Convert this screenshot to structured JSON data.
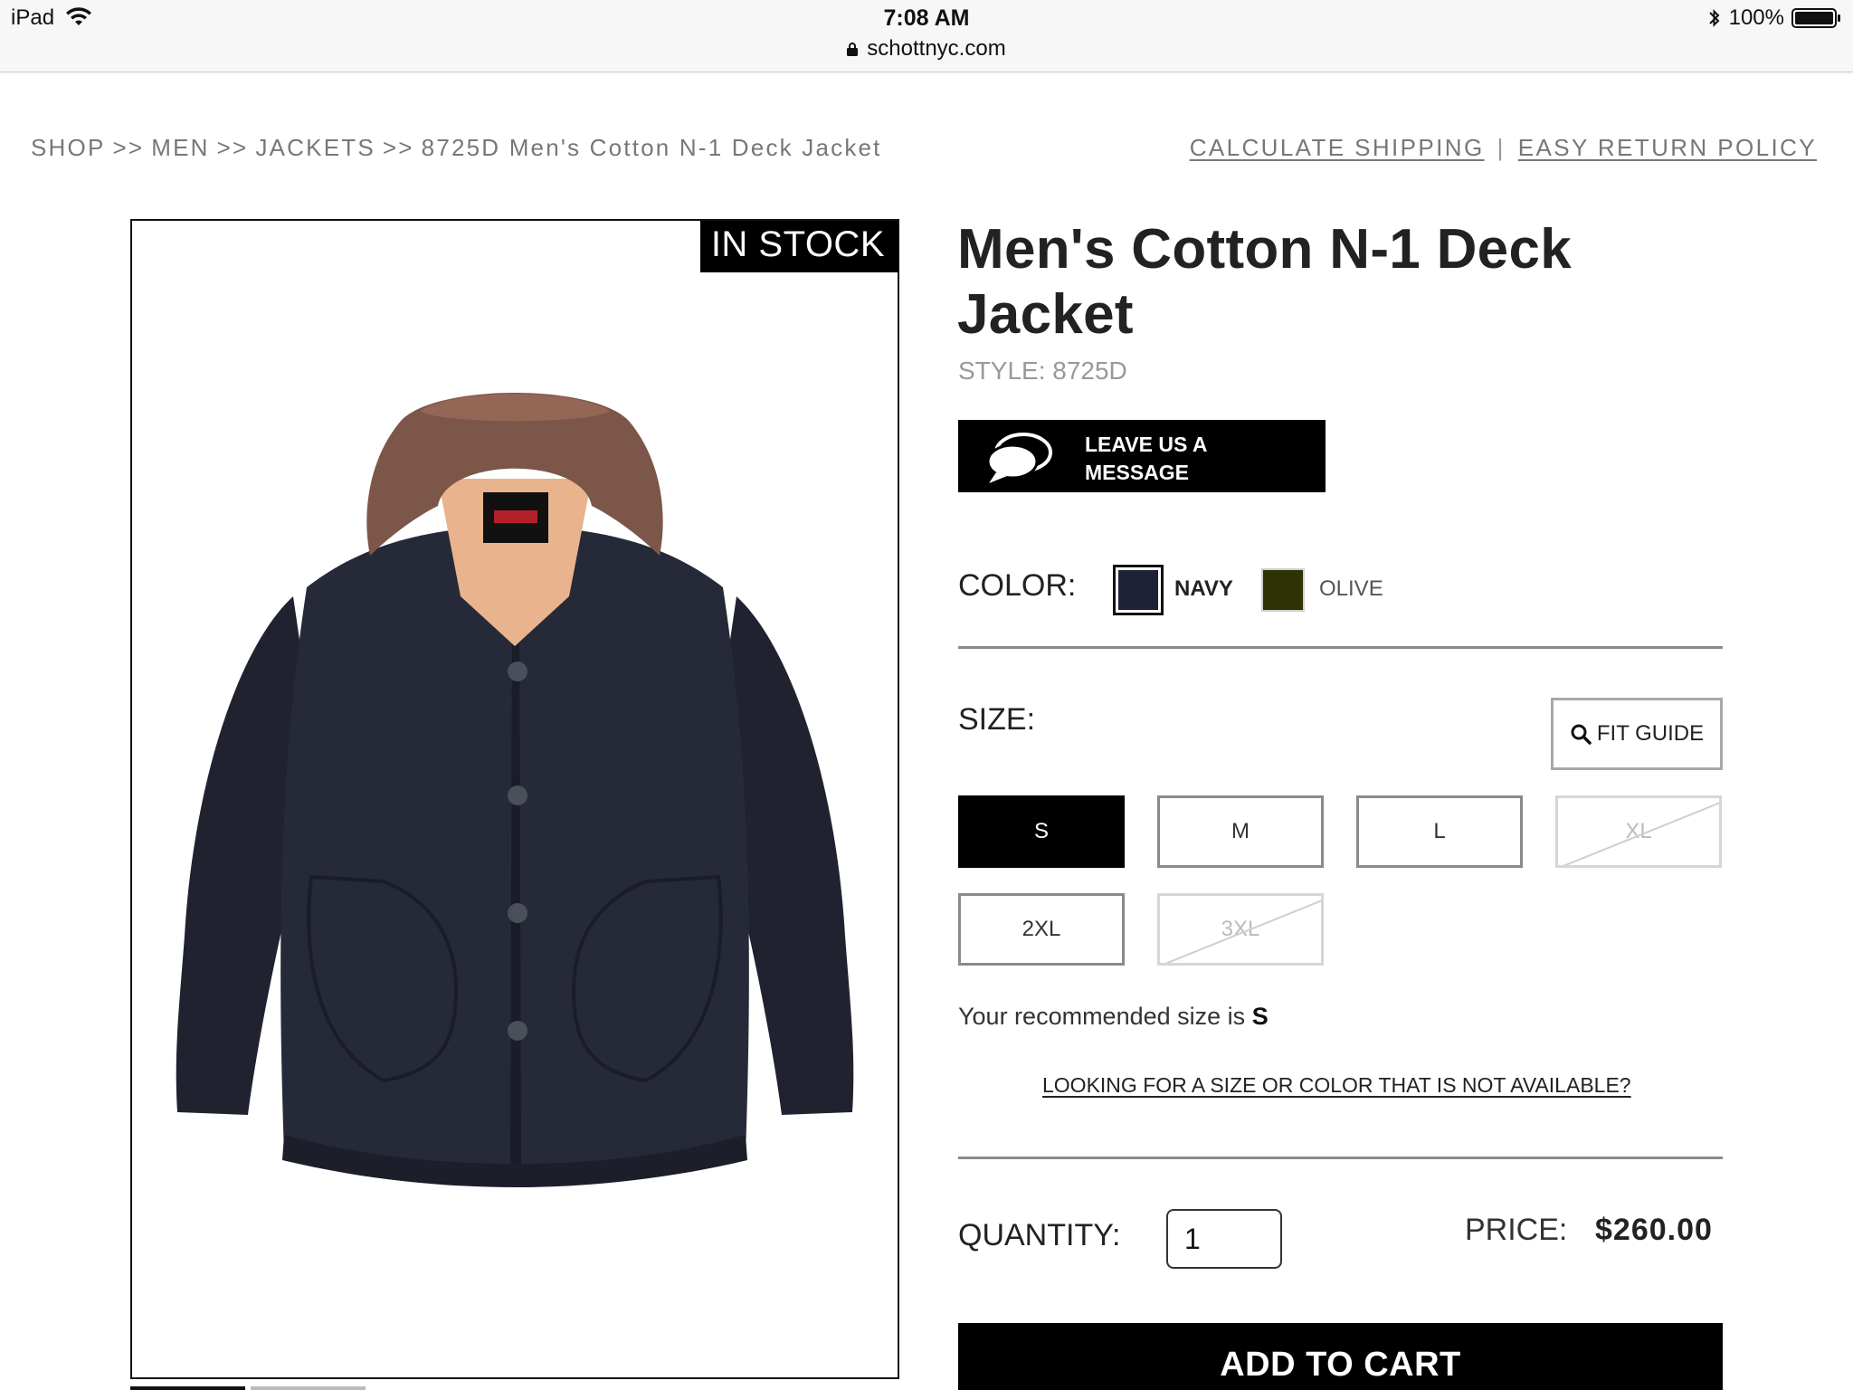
{
  "status_bar": {
    "device": "iPad",
    "time": "7:08 AM",
    "url": "schottnyc.com",
    "battery": "100%"
  },
  "breadcrumb": {
    "items": [
      "SHOP",
      "MEN",
      "JACKETS",
      "8725D Men's Cotton N-1 Deck Jacket"
    ],
    "separator": ">>"
  },
  "top_links": {
    "shipping": "CALCULATE SHIPPING",
    "divider": "|",
    "returns": "EASY RETURN POLICY"
  },
  "product": {
    "stock_badge": "IN STOCK",
    "title": "Men's Cotton N-1 Deck Jacket",
    "style": "STYLE: 8725D",
    "message_button": "LEAVE US A MESSAGE",
    "color_label": "COLOR:",
    "colors": [
      {
        "name": "NAVY",
        "hex": "#1d2236",
        "selected": true
      },
      {
        "name": "OLIVE",
        "hex": "#2e3205",
        "selected": false
      }
    ],
    "size_label": "SIZE:",
    "fit_guide": "FIT GUIDE",
    "sizes": [
      {
        "label": "S",
        "state": "selected"
      },
      {
        "label": "M",
        "state": "available"
      },
      {
        "label": "L",
        "state": "available"
      },
      {
        "label": "XL",
        "state": "unavailable"
      },
      {
        "label": "2XL",
        "state": "available"
      },
      {
        "label": "3XL",
        "state": "unavailable"
      }
    ],
    "recommended_prefix": "Your recommended size is",
    "recommended_size": "S",
    "not_available_link": "LOOKING FOR A SIZE OR COLOR THAT IS NOT AVAILABLE?",
    "quantity_label": "QUANTITY:",
    "quantity_value": "1",
    "price_label": "PRICE:",
    "price_value": "$260.00",
    "add_to_cart": "ADD TO CART"
  },
  "icons": {
    "wifi": "wifi-icon",
    "lock": "lock-icon",
    "bluetooth": "bluetooth-icon",
    "battery": "battery-icon",
    "chat": "chat-bubbles-icon",
    "search": "search-icon"
  },
  "colors": {
    "badge_bg": "#000000",
    "muted_text": "#777777",
    "button_bg": "#000000"
  }
}
